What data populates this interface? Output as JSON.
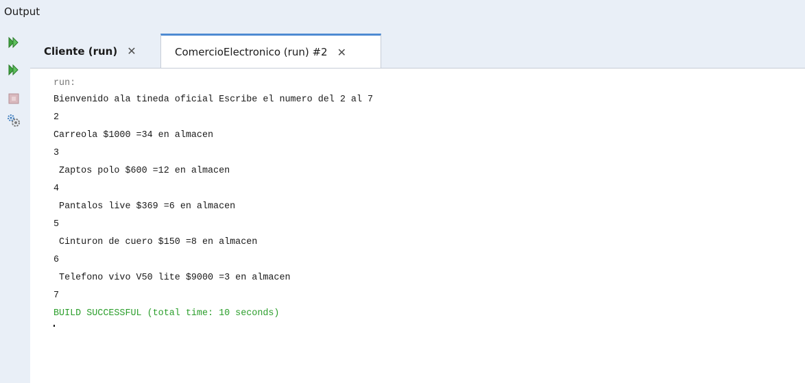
{
  "window": {
    "title": "Output"
  },
  "tabs": [
    {
      "label": "Cliente (run)",
      "close": "✕"
    },
    {
      "label": "ComercioElectronico (run) #2",
      "close": "✕"
    }
  ],
  "toolbar": {
    "icons": [
      "rerun-icon",
      "rerun-with-args-icon",
      "stop-icon",
      "settings-icon"
    ]
  },
  "console": {
    "lines": [
      "run:",
      "Bienvenido ala tineda oficial Escribe el numero del 2 al 7",
      "2",
      "Carreola $1000 =34 en almacen",
      "3",
      " Zaptos polo $600 =12 en almacen",
      "4",
      " Pantalos live $369 =6 en almacen",
      "5",
      " Cinturon de cuero $150 =8 en almacen",
      "6",
      " Telefono vivo V50 lite $9000 =3 en almacen",
      "7",
      "BUILD SUCCESSFUL (total time: 10 seconds)"
    ]
  },
  "colors": {
    "panel_bg": "#e9eff7",
    "active_tab_accent": "#4d8ad2",
    "success_text": "#2b9e2b",
    "run_text": "#777777"
  }
}
